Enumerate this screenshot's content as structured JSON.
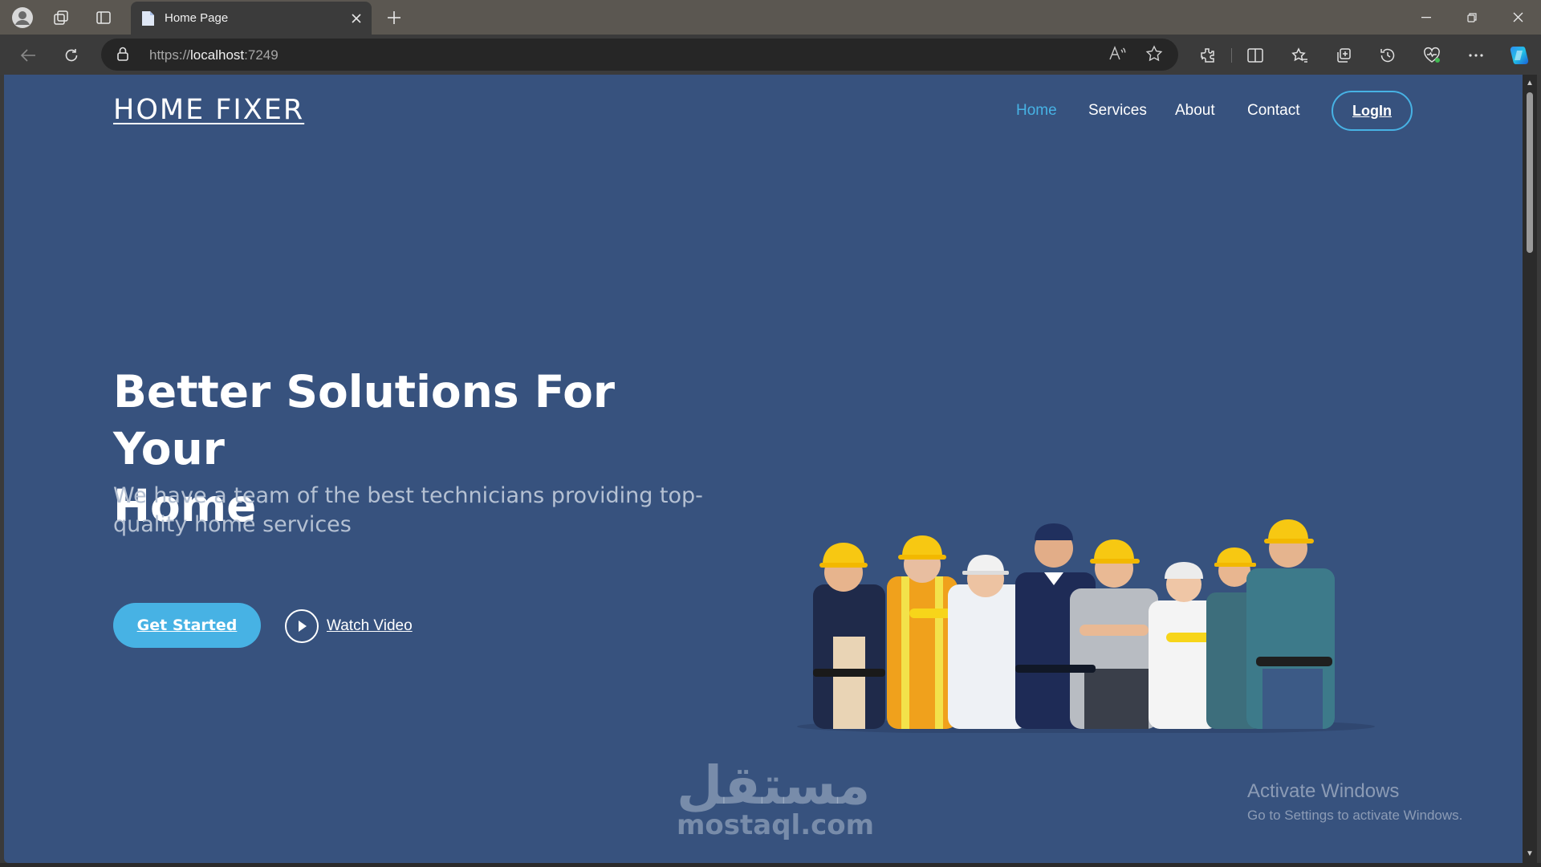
{
  "browser": {
    "tab_title": "Home Page",
    "url_scheme": "https://",
    "url_host": "localhost",
    "url_port": ":7249",
    "icons": [
      "profile-icon",
      "workspaces-icon",
      "tab-actions-icon",
      "page-icon",
      "close-icon",
      "plus-icon",
      "back-icon",
      "refresh-icon",
      "lock-icon",
      "read-aloud-icon",
      "favorite-star-icon",
      "extensions-icon",
      "split-screen-icon",
      "favorites-icon",
      "collections-icon",
      "history-icon",
      "browser-essentials-icon",
      "more-icon",
      "copilot-icon"
    ]
  },
  "site": {
    "logo": "HOME FIXER",
    "nav": [
      "Home",
      "Services",
      "About",
      "Contact"
    ],
    "login": "LogIn",
    "accent_color": "#47b2e4",
    "background_color": "#37527e"
  },
  "hero": {
    "title_line1": "Better Solutions For Your",
    "title_line2": "Home",
    "subtitle": "We have a team of the best technicians providing top-quality home services",
    "cta_primary": "Get Started",
    "cta_secondary": "Watch Video",
    "image_alt": "team of technicians"
  },
  "overlay": {
    "watermark_ar": "مستقل",
    "watermark_en": "mostaql.com",
    "activate_title": "Activate Windows",
    "activate_sub": "Go to Settings to activate Windows."
  }
}
